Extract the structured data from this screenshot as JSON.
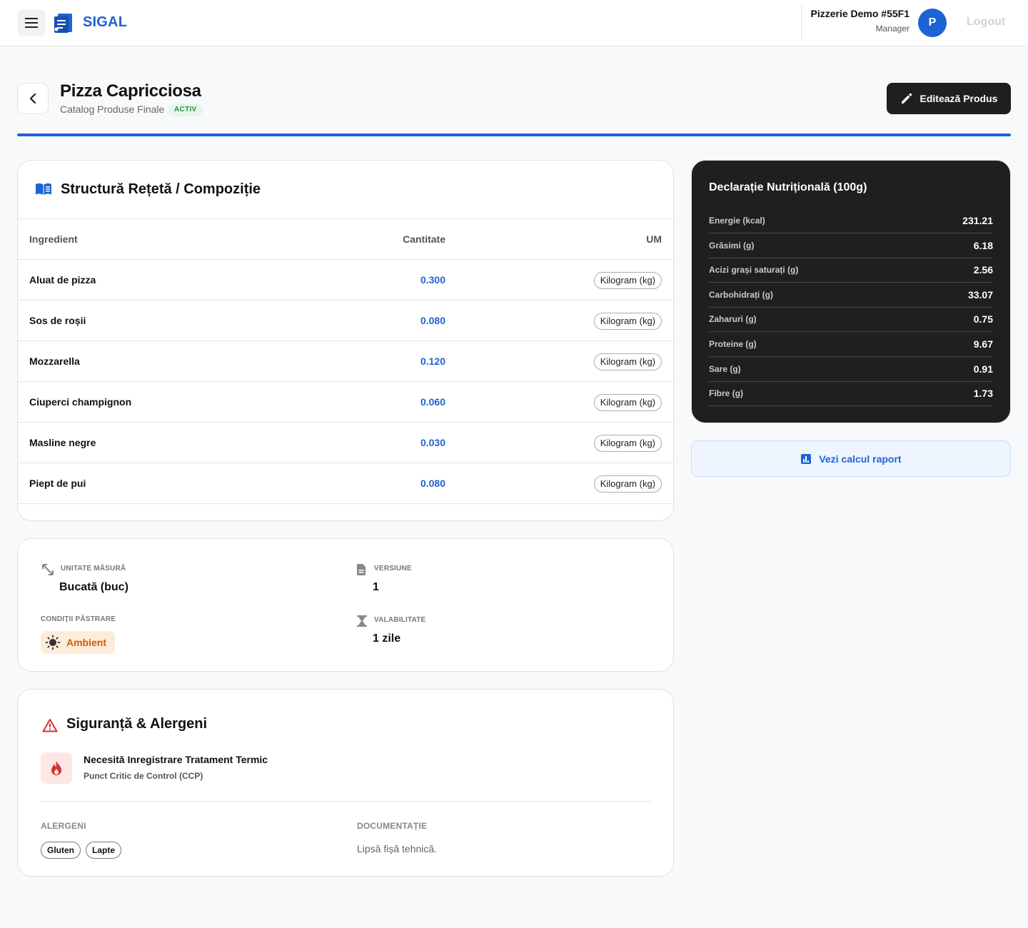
{
  "app": {
    "name": "SIGAL"
  },
  "user": {
    "tenant": "Pizzerie Demo #55F1",
    "role": "Manager",
    "avatar_letter": "P",
    "logout_label": "Logout"
  },
  "product": {
    "title": "Pizza Capricciosa",
    "catalog": "Catalog Produse Finale",
    "status": "ACTIV",
    "edit_label": "Editează Produs"
  },
  "recipe": {
    "title": "Structură Rețetă / Compoziție",
    "columns": {
      "ingredient": "Ingredient",
      "quantity": "Cantitate",
      "unit": "UM"
    },
    "rows": [
      {
        "name": "Aluat de pizza",
        "qty": "0.300",
        "um": "Kilogram (kg)"
      },
      {
        "name": "Sos de roșii",
        "qty": "0.080",
        "um": "Kilogram (kg)"
      },
      {
        "name": "Mozzarella",
        "qty": "0.120",
        "um": "Kilogram (kg)"
      },
      {
        "name": "Ciuperci champignon",
        "qty": "0.060",
        "um": "Kilogram (kg)"
      },
      {
        "name": "Masline negre",
        "qty": "0.030",
        "um": "Kilogram (kg)"
      },
      {
        "name": "Piept de pui",
        "qty": "0.080",
        "um": "Kilogram (kg)"
      }
    ]
  },
  "info": {
    "unit_label": "UNITATE MĂSURĂ",
    "unit_value": "Bucată (buc)",
    "version_label": "VERSIUNE",
    "version_value": "1",
    "storage_label": "CONDIȚII PĂSTRARE",
    "storage_value": "Ambient",
    "validity_label": "VALABILITATE",
    "validity_value": "1 zile"
  },
  "safety": {
    "title": "Siguranță & Alergeni",
    "ccp_title": "Necesită Inregistrare Tratament Termic",
    "ccp_sub": "Punct Critic de Control (CCP)",
    "allergens_label": "ALERGENI",
    "allergens": [
      "Gluten",
      "Lapte"
    ],
    "docs_label": "DOCUMENTAȚIE",
    "docs_value": "Lipsă fișă tehnică."
  },
  "nutrition": {
    "title": "Declarație Nutrițională (100g)",
    "rows": [
      {
        "label": "Energie (kcal)",
        "value": "231.21"
      },
      {
        "label": "Grăsimi (g)",
        "value": "6.18"
      },
      {
        "label": "Acizi grași saturați (g)",
        "value": "2.56"
      },
      {
        "label": "Carbohidrați (g)",
        "value": "33.07"
      },
      {
        "label": "Zaharuri (g)",
        "value": "0.75"
      },
      {
        "label": "Proteine (g)",
        "value": "9.67"
      },
      {
        "label": "Sare (g)",
        "value": "0.91"
      },
      {
        "label": "Fibre (g)",
        "value": "1.73"
      }
    ],
    "report_label": "Vezi calcul raport"
  },
  "colors": {
    "brand": "#1d63d6",
    "dark": "#1e1f21",
    "active_badge": "#2a8a45",
    "warning": "#d05a10",
    "danger": "#d32f2f"
  }
}
